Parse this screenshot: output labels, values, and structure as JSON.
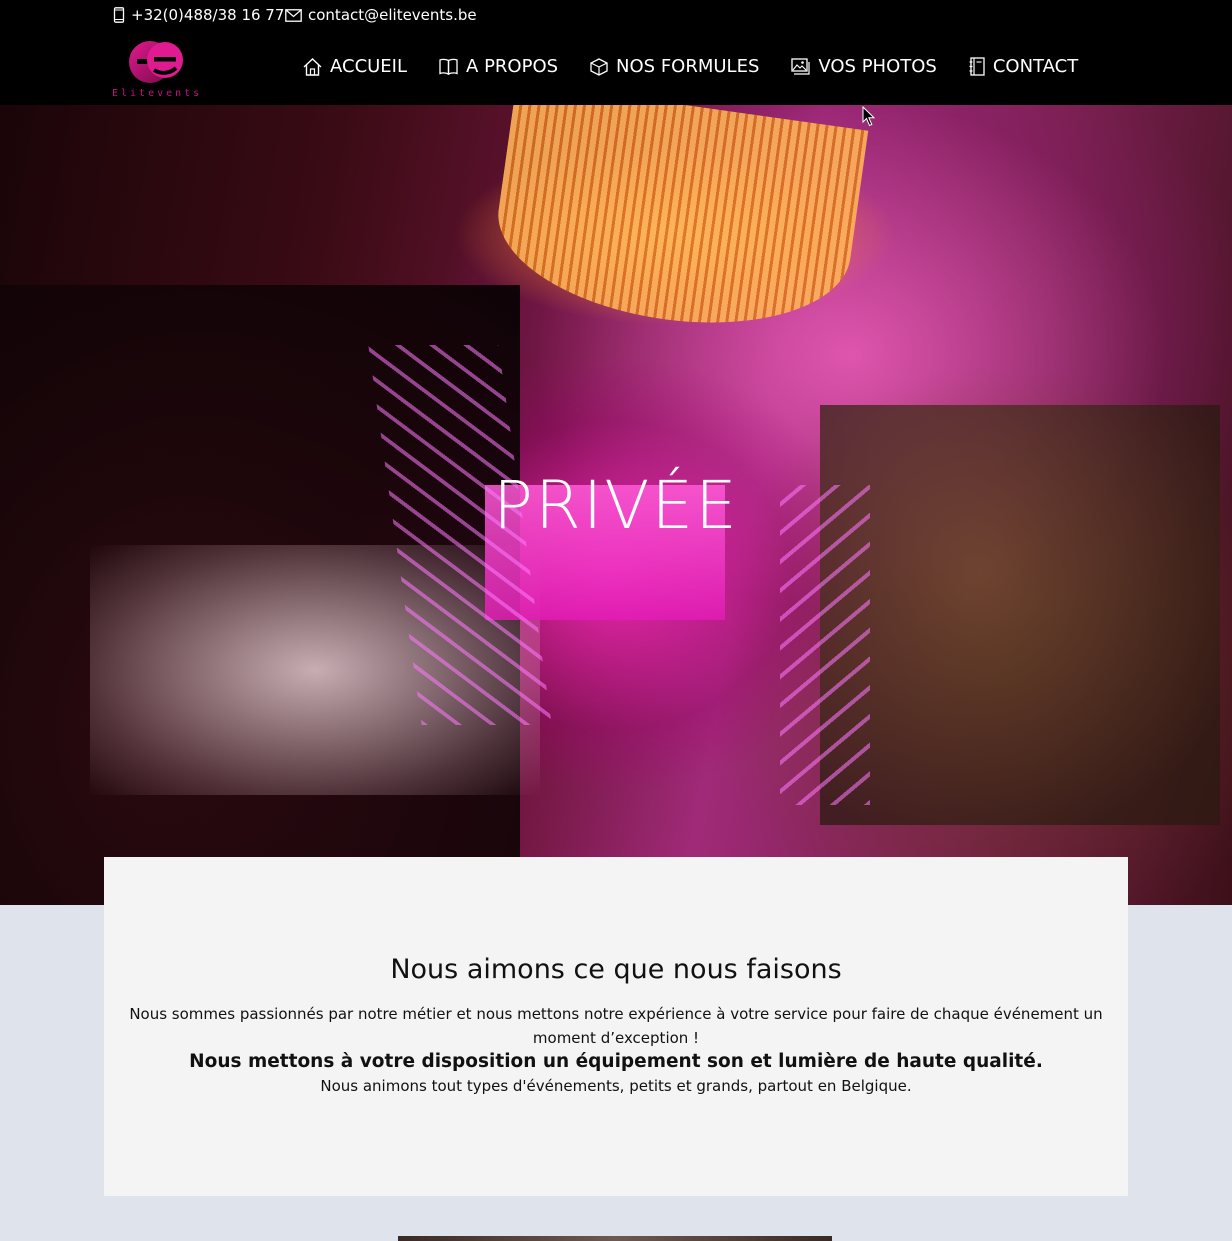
{
  "topbar": {
    "phone": "+32(0)488/38 16 77",
    "email": "contact@elitevents.be",
    "phone_icon": "mobile-phone-icon",
    "email_icon": "envelope-icon"
  },
  "brand": {
    "logo_text": "Elitevents",
    "accent_color": "#c4127f"
  },
  "nav": {
    "items": [
      {
        "label": "ACCUEIL",
        "icon": "home-icon"
      },
      {
        "label": "A PROPOS",
        "icon": "book-icon"
      },
      {
        "label": "NOS FORMULES",
        "icon": "box-icon"
      },
      {
        "label": "VOS PHOTOS",
        "icon": "images-icon"
      },
      {
        "label": "CONTACT",
        "icon": "notebook-icon"
      }
    ]
  },
  "hero": {
    "title": "PRIVÉE"
  },
  "intro": {
    "heading": "Nous aimons ce que nous faisons",
    "paragraph": "Nous sommes passionnés par notre métier et nous mettons notre expérience à votre service pour faire de chaque événement un moment d’exception !",
    "subheading": "Nous mettons à votre disposition un équipement son et lumière de haute qualité.",
    "paragraph2": "Nous animons tout types d'événements, petits et grands, partout en Belgique."
  }
}
